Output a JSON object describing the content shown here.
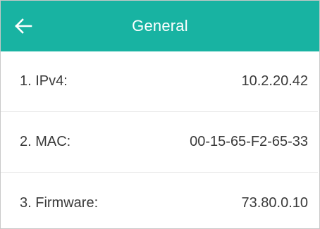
{
  "header": {
    "title": "General",
    "back_icon": "arrow-left-icon",
    "background_color": "#18b3a2"
  },
  "rows": [
    {
      "label": "1. IPv4:",
      "value": "10.2.20.42"
    },
    {
      "label": "2. MAC:",
      "value": "00-15-65-F2-65-33"
    },
    {
      "label": "3. Firmware:",
      "value": "73.80.0.10"
    }
  ]
}
